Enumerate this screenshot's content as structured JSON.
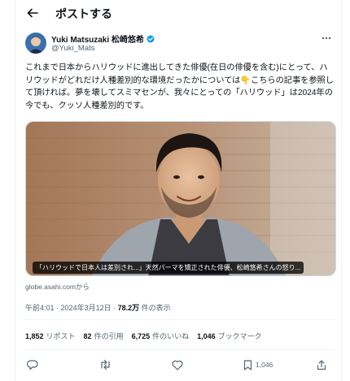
{
  "header": {
    "title": "ポストする",
    "back_icon": "arrow-left-icon"
  },
  "author": {
    "display_name": "Yuki Matsuzaki 松崎悠希",
    "handle": "@Yuki_Mats",
    "verified_icon": "verified-badge-icon"
  },
  "tweet": {
    "text": "これまで日本からハリウッドに進出してきた俳優(在日の俳優を含む)にとって、ハリウッドがどれだけ人種差別的な環境だったかについては👇こちらの記事を参照して頂ければ。夢を壊してスミマセンが、我々にとっての「ハリウッド」は2024年の今でも、クッソ人種差別的です。"
  },
  "media": {
    "caption": "「ハリウッドで日本人は差別され...」天然パーマを矯正された俳優、松崎悠希さんの怒り...",
    "source": "globe.asahi.comから"
  },
  "meta": {
    "time": "午前4:01",
    "date": "2024年3月12日",
    "views_count": "78.2万",
    "views_label": "件の表示"
  },
  "stats": {
    "reposts_count": "1,852",
    "reposts_label": "リポスト",
    "quotes_count": "82",
    "quotes_label": "件の引用",
    "likes_count": "6,725",
    "likes_label": "件のいいね",
    "bookmarks_count": "1,046",
    "bookmarks_label": "ブックマーク"
  },
  "actions": {
    "bookmark_count": "1,046",
    "icons": [
      "reply-icon",
      "repost-icon",
      "like-icon",
      "bookmark-icon",
      "share-icon"
    ]
  },
  "colors": {
    "text": "#0f1419",
    "muted": "#536471",
    "border": "#eff3f4"
  }
}
